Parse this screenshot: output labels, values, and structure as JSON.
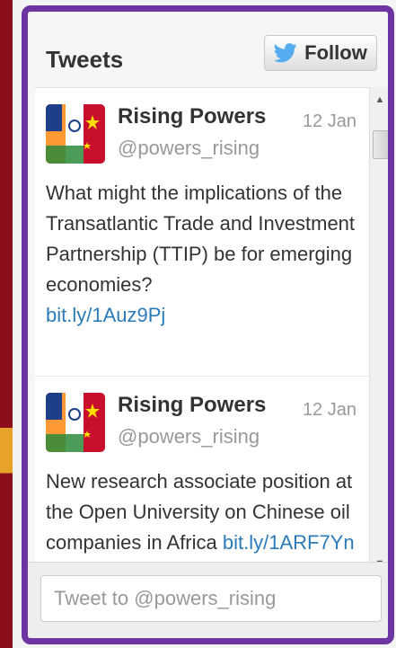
{
  "widget": {
    "title": "Tweets",
    "follow_label": "Follow",
    "composer_placeholder": "Tweet to @powers_rising"
  },
  "tweets": [
    {
      "name": "Rising Powers",
      "handle": "@powers_rising",
      "date": "12 Jan",
      "text": "What might the implications of the Transatlantic Trade and Investment Partnership (TTIP) be for emerging economies?",
      "link": "bit.ly/1Auz9Pj"
    },
    {
      "name": "Rising Powers",
      "handle": "@powers_rising",
      "date": "12 Jan",
      "text": "New research associate position at the Open University on Chinese oil companies in Africa",
      "link": "bit.ly/1ARF7Yn"
    }
  ],
  "colors": {
    "frame": "#6c35a2",
    "link": "#2b7bb9",
    "twitter_bird": "#55acee"
  },
  "icons": {
    "follow": "twitter-bird-icon",
    "scroll_up": "scroll-up-arrow-icon",
    "scroll_down": "scroll-down-arrow-icon"
  }
}
